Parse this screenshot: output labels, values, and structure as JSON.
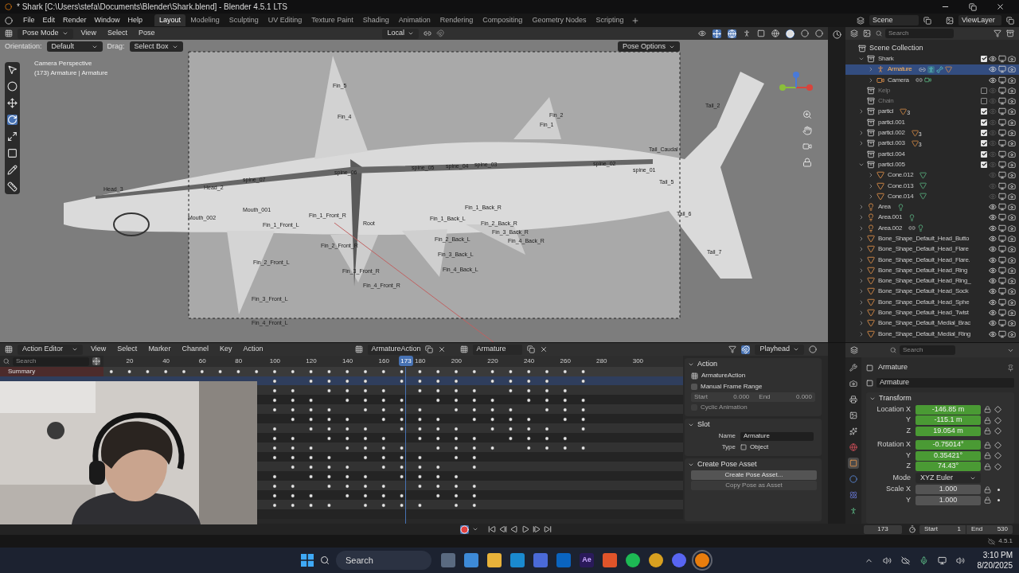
{
  "title_bar": {
    "title": "* Shark [C:\\Users\\stefa\\Documents\\Blender\\Shark.blend] - Blender 4.5.1 LTS"
  },
  "menu": [
    "File",
    "Edit",
    "Render",
    "Window",
    "Help"
  ],
  "workspaces": [
    {
      "label": "Layout",
      "selected": true
    },
    {
      "label": "Modeling",
      "selected": false
    },
    {
      "label": "Sculpting",
      "selected": false
    },
    {
      "label": "UV Editing",
      "selected": false
    },
    {
      "label": "Texture Paint",
      "selected": false
    },
    {
      "label": "Shading",
      "selected": false
    },
    {
      "label": "Animation",
      "selected": false
    },
    {
      "label": "Rendering",
      "selected": false
    },
    {
      "label": "Compositing",
      "selected": false
    },
    {
      "label": "Geometry Nodes",
      "selected": false
    },
    {
      "label": "Scripting",
      "selected": false
    }
  ],
  "scene": {
    "scene": "Scene",
    "view_layer": "ViewLayer"
  },
  "viewport": {
    "mode": "Pose Mode",
    "menus": [
      "View",
      "Select",
      "Pose"
    ],
    "transform_orientation": "Local",
    "orientation_label": "Orientation:",
    "orientation": "Default",
    "drag_label": "Drag:",
    "drag": "Select Box",
    "pose_options": "Pose Options",
    "overlay_text": [
      "Camera Perspective",
      "(173) Armature | Armature"
    ],
    "bones": [
      {
        "label": "Fin_5"
      },
      {
        "label": "Fin_4"
      },
      {
        "label": "Fin_2"
      },
      {
        "label": "Fin_1"
      },
      {
        "label": "Tail_2"
      },
      {
        "label": "Tail_Caudal"
      },
      {
        "label": "Tail_5"
      },
      {
        "label": "Tail_6"
      },
      {
        "label": "Tail_7"
      },
      {
        "label": "spine_07"
      },
      {
        "label": "spine_06"
      },
      {
        "label": "spine_05"
      },
      {
        "label": "spine_04"
      },
      {
        "label": "spine_03"
      },
      {
        "label": "spine_02"
      },
      {
        "label": "spine_01"
      },
      {
        "label": "Head_3"
      },
      {
        "label": "Head_2"
      },
      {
        "label": "Mouth_001"
      },
      {
        "label": "Mouth_002"
      },
      {
        "label": "Root"
      },
      {
        "label": "Fin_1_Front_R"
      },
      {
        "label": "Fin_2_Front_R"
      },
      {
        "label": "Fin_3_Front_R"
      },
      {
        "label": "Fin_4_Front_R"
      },
      {
        "label": "Fin_1_Front_L"
      },
      {
        "label": "Fin_2_Front_L"
      },
      {
        "label": "Fin_3_Front_L"
      },
      {
        "label": "Fin_4_Front_L"
      },
      {
        "label": "Fin_1_Back_R"
      },
      {
        "label": "Fin_2_Back_R"
      },
      {
        "label": "Fin_3_Back_R"
      },
      {
        "label": "Fin_4_Back_R"
      },
      {
        "label": "Fin_1_Back_L"
      },
      {
        "label": "Fin_2_Back_L"
      },
      {
        "label": "Fin_3_Back_L"
      },
      {
        "label": "Fin_4_Back_L"
      }
    ]
  },
  "outliner": {
    "search_placeholder": "Search",
    "root": "Scene Collection",
    "items": [
      {
        "name": "Shark",
        "kind": "collection",
        "checked": true,
        "visible": true,
        "selected": false,
        "expanded": true,
        "children": [
          {
            "name": "Armature",
            "kind": "armature",
            "visible": true,
            "selected": true,
            "expanded": false,
            "extras": [
              {
                "kind": "link"
              },
              {
                "kind": "pose"
              },
              {
                "kind": "armature_data"
              },
              {
                "kind": "mesh"
              }
            ]
          },
          {
            "name": "Camera",
            "kind": "camera",
            "visible": true,
            "selected": false,
            "expanded": false,
            "extras": [
              {
                "kind": "link"
              },
              {
                "kind": "camera_data"
              }
            ]
          }
        ]
      },
      {
        "name": "Kelp",
        "kind": "collection",
        "checked": false,
        "visible": false,
        "selected": false
      },
      {
        "name": "Chain",
        "kind": "collection",
        "checked": false,
        "visible": false,
        "selected": false
      },
      {
        "name": "particl",
        "kind": "collection",
        "checked": true,
        "visible": false,
        "selected": false,
        "expanded": false,
        "extras": [
          {
            "kind": "mesh",
            "count": "3"
          }
        ]
      },
      {
        "name": "particl.001",
        "kind": "collection",
        "checked": true,
        "visible": false,
        "selected": false
      },
      {
        "name": "particl.002",
        "kind": "collection",
        "checked": true,
        "visible": false,
        "selected": false,
        "expanded": false,
        "extras": [
          {
            "kind": "mesh",
            "count": "3"
          }
        ]
      },
      {
        "name": "particl.003",
        "kind": "collection",
        "checked": true,
        "visible": false,
        "selected": false,
        "expanded": false,
        "extras": [
          {
            "kind": "mesh",
            "count": "3"
          }
        ]
      },
      {
        "name": "particl.004",
        "kind": "collection",
        "checked": true,
        "visible": false,
        "selected": false
      },
      {
        "name": "particl.005",
        "kind": "collection",
        "checked": true,
        "visible": false,
        "selected": false,
        "expanded": true,
        "children": [
          {
            "name": "Cone.012",
            "kind": "mesh",
            "visible": false,
            "selected": false,
            "expanded": false,
            "extras": [
              {
                "kind": "mesh_data"
              }
            ]
          },
          {
            "name": "Cone.013",
            "kind": "mesh",
            "visible": false,
            "selected": false,
            "expanded": false,
            "extras": [
              {
                "kind": "mesh_data"
              }
            ]
          },
          {
            "name": "Cone.014",
            "kind": "mesh",
            "visible": false,
            "selected": false,
            "expanded": false,
            "extras": [
              {
                "kind": "mesh_data"
              }
            ]
          }
        ]
      },
      {
        "name": "Area",
        "kind": "light",
        "visible": true,
        "selected": false,
        "expanded": false,
        "extras": [
          {
            "kind": "light_data"
          }
        ]
      },
      {
        "name": "Area.001",
        "kind": "light",
        "visible": true,
        "selected": false,
        "expanded": false,
        "extras": [
          {
            "kind": "light_data"
          }
        ]
      },
      {
        "name": "Area.002",
        "kind": "light",
        "visible": true,
        "selected": false,
        "expanded": false,
        "extras": [
          {
            "kind": "link"
          },
          {
            "kind": "light_data"
          }
        ]
      },
      {
        "name": "Bone_Shape_Default_Head_Butto",
        "kind": "mesh",
        "visible": true,
        "selected": false,
        "expanded": false
      },
      {
        "name": "Bone_Shape_Default_Head_Flare",
        "kind": "mesh",
        "visible": true,
        "selected": false,
        "expanded": false
      },
      {
        "name": "Bone_Shape_Default_Head_Flare.",
        "kind": "mesh",
        "visible": true,
        "selected": false,
        "expanded": false
      },
      {
        "name": "Bone_Shape_Default_Head_Ring",
        "kind": "mesh",
        "visible": true,
        "selected": false,
        "expanded": false
      },
      {
        "name": "Bone_Shape_Default_Head_Ring_",
        "kind": "mesh",
        "visible": true,
        "selected": false,
        "expanded": false
      },
      {
        "name": "Bone_Shape_Default_Head_Sock",
        "kind": "mesh",
        "visible": true,
        "selected": false,
        "expanded": false
      },
      {
        "name": "Bone_Shape_Default_Head_Sphe",
        "kind": "mesh",
        "visible": true,
        "selected": false,
        "expanded": false
      },
      {
        "name": "Bone_Shape_Default_Head_Twist",
        "kind": "mesh",
        "visible": true,
        "selected": false,
        "expanded": false
      },
      {
        "name": "Bone_Shape_Default_Medial_Brac",
        "kind": "mesh",
        "visible": true,
        "selected": false,
        "expanded": false
      },
      {
        "name": "Bone_Shape_Default_Medial_Ring",
        "kind": "mesh",
        "visible": true,
        "selected": false,
        "expanded": false
      }
    ]
  },
  "action_editor": {
    "mode": "Action Editor",
    "menus": [
      "View",
      "Select",
      "Marker",
      "Channel",
      "Key",
      "Action"
    ],
    "action": "ArmatureAction",
    "slot": "Armature",
    "playhead_menu": "Playhead",
    "search_placeholder": "Search",
    "ruler": [
      "20",
      "40",
      "60",
      "80",
      "100",
      "120",
      "140",
      "160",
      "180",
      "200",
      "220",
      "240",
      "260",
      "280",
      "300"
    ],
    "playhead": {
      "label": "173",
      "level": 0.51
    },
    "summary": "Summary",
    "action_panel": {
      "title": "Action",
      "action": "ArmatureAction",
      "manual_range": {
        "label": "Manual Frame Range",
        "checked": false
      },
      "start_label": "Start",
      "start": "0.000",
      "end_label": "End",
      "end": "0.000",
      "cyclic": {
        "label": "Cyclic Animation",
        "checked": false
      }
    },
    "slot_panel": {
      "title": "Slot",
      "name_label": "Name",
      "name": "Armature",
      "type_label": "Type",
      "type": "Object"
    },
    "pose_panel": {
      "title": "Create Pose Asset",
      "buttons": [
        {
          "label": "Create Pose Asset...",
          "disabled": false
        },
        {
          "label": "Copy Pose as Asset",
          "disabled": true
        }
      ]
    }
  },
  "properties": {
    "search_placeholder": "Search",
    "tabs": [
      {
        "kind": "tool",
        "selected": false
      },
      {
        "kind": "render",
        "selected": false
      },
      {
        "kind": "output",
        "selected": false
      },
      {
        "kind": "view_layer",
        "selected": false
      },
      {
        "kind": "scene",
        "selected": false
      },
      {
        "kind": "world",
        "selected": false
      },
      {
        "kind": "object",
        "selected": true
      },
      {
        "kind": "physics",
        "selected": false
      },
      {
        "kind": "constraints",
        "selected": false
      },
      {
        "kind": "data",
        "selected": false
      }
    ],
    "object": "Armature",
    "datablock": "Armature",
    "panel": "Transform",
    "location": [
      {
        "label": "Location X",
        "value": "-146.85 m",
        "keyed": true
      },
      {
        "label": "Y",
        "value": "-115.1 m",
        "keyed": true
      },
      {
        "label": "Z",
        "value": "19.054 m",
        "keyed": true
      }
    ],
    "rotation": [
      {
        "label": "Rotation X",
        "value": "-0.75014°",
        "keyed": true
      },
      {
        "label": "Y",
        "value": "0.35421°",
        "keyed": true
      },
      {
        "label": "Z",
        "value": "74.43°",
        "keyed": true
      }
    ],
    "mode": {
      "label": "Mode",
      "value": "XYZ Euler"
    },
    "scale": [
      {
        "label": "Scale X",
        "value": "1.000",
        "keyed": false
      },
      {
        "label": "Y",
        "value": "1.000",
        "keyed": false
      }
    ]
  },
  "timeline": {
    "current": "173",
    "start_label": "Start",
    "start": "1",
    "end_label": "End",
    "end": "530"
  },
  "status_bar": {
    "version": "4.5.1"
  },
  "taskbar": {
    "search_placeholder": "Search",
    "apps": [
      {
        "kind": "task_view",
        "selected": false
      },
      {
        "kind": "copilot",
        "selected": false
      },
      {
        "kind": "explorer",
        "selected": false
      },
      {
        "kind": "edge",
        "selected": false
      },
      {
        "kind": "store",
        "selected": false
      },
      {
        "kind": "outlook",
        "selected": false
      },
      {
        "kind": "after_effects",
        "label": "Ae",
        "selected": false
      },
      {
        "kind": "brave",
        "selected": false
      },
      {
        "kind": "spotify",
        "selected": false
      },
      {
        "kind": "chrome",
        "selected": false
      },
      {
        "kind": "discord",
        "selected": false
      },
      {
        "kind": "blender",
        "selected": true
      }
    ],
    "time": "3:10 PM",
    "date": "8/20/2025"
  }
}
